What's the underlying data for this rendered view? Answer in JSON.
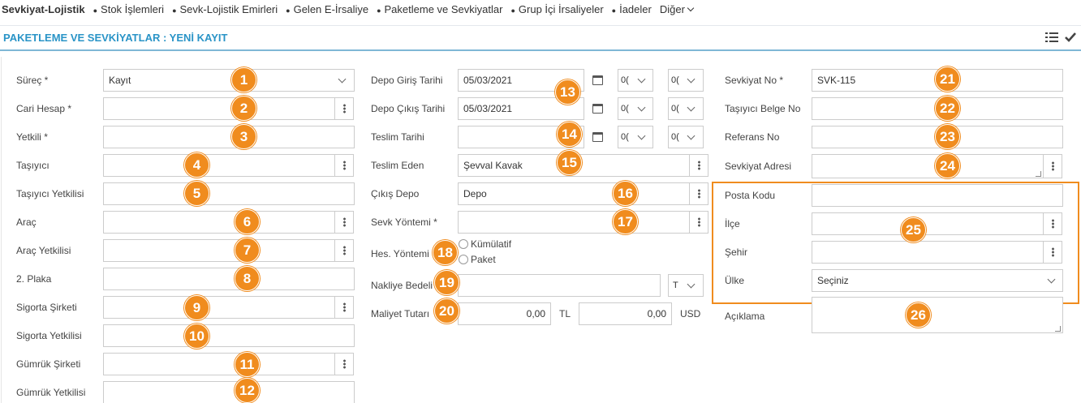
{
  "nav": {
    "brand": "Sevkiyat-Lojistik",
    "items": [
      "Stok İşlemleri",
      "Sevk-Lojistik Emirleri",
      "Gelen E-İrsaliye",
      "Paketleme ve Sevkiyatlar",
      "Grup İçi İrsaliyeler",
      "İadeler"
    ],
    "more": "Diğer"
  },
  "page": {
    "title": "PAKETLEME VE SEVKİYATLAR : YENİ KAYIT",
    "tool_icons": [
      "list-icon",
      "check-icon"
    ]
  },
  "col1": {
    "surec_label": "Süreç *",
    "surec_value": "Kayıt",
    "cari_label": "Cari Hesap *",
    "yetkili_label": "Yetkili *",
    "tasiyici_label": "Taşıyıcı",
    "tasiyici_yetkili_label": "Taşıyıcı Yetkilisi",
    "arac_label": "Araç",
    "arac_yetkili_label": "Araç Yetkilisi",
    "plaka_label": "2. Plaka",
    "sigorta_label": "Sigorta Şirketi",
    "sigorta_yetkili_label": "Sigorta Yetkilisi",
    "gumruk_label": "Gümrük Şirketi",
    "gumruk_yetkili_label": "Gümrük Yetkilisi"
  },
  "col2": {
    "giris_label": "Depo Giriş Tarihi",
    "giris_value": "05/03/2021",
    "cikis_label": "Depo Çıkış Tarihi",
    "cikis_value": "05/03/2021",
    "teslim_tarihi_label": "Teslim Tarihi",
    "time_hour": "0(",
    "time_min": "0(",
    "teslim_eden_label": "Teslim Eden",
    "teslim_eden_value": "Şevval Kavak",
    "cikis_depo_label": "Çıkış Depo",
    "cikis_depo_value": "Depo",
    "sevk_yontemi_label": "Sevk Yöntemi *",
    "hes_yontemi_label": "Hes. Yöntemi",
    "radio_1": "Kümülatif",
    "radio_2": "Paket",
    "nakliye_label": "Nakliye Bedeli",
    "nakliye_currency": "T",
    "maliyet_label": "Maliyet Tutarı",
    "maliyet_tl_value": "0,00",
    "maliyet_tl_unit": "TL",
    "maliyet_usd_value": "0,00",
    "maliyet_usd_unit": "USD"
  },
  "col3": {
    "sevkiyat_no_label": "Sevkiyat No *",
    "sevkiyat_no_value": "SVK-115",
    "tasiyici_belge_label": "Taşıyıcı Belge No",
    "referans_label": "Referans No",
    "sevkiyat_adresi_label": "Sevkiyat Adresi",
    "posta_kodu_label": "Posta Kodu",
    "ilce_label": "İlçe",
    "sehir_label": "Şehir",
    "ulke_label": "Ülke",
    "ulke_value": "Seçiniz",
    "aciklama_label": "Açıklama"
  },
  "badges": [
    "1",
    "2",
    "3",
    "4",
    "5",
    "6",
    "7",
    "8",
    "9",
    "10",
    "11",
    "12",
    "13",
    "14",
    "15",
    "16",
    "17",
    "18",
    "19",
    "20",
    "21",
    "22",
    "23",
    "24",
    "25",
    "26"
  ],
  "colors": {
    "accent": "#2a94c7",
    "badge": "#f08c1e"
  }
}
